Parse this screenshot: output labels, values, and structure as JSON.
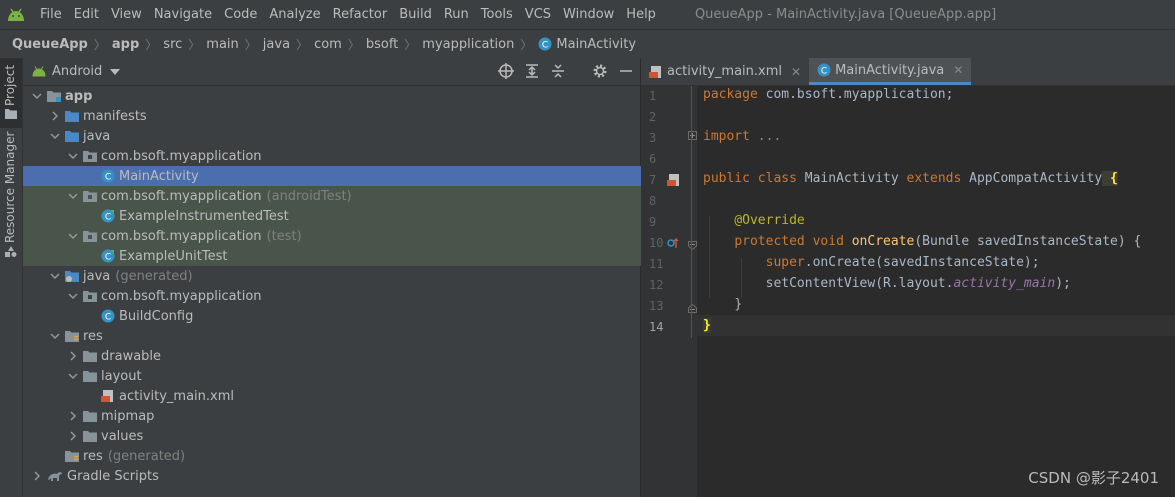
{
  "menubar": {
    "items": [
      "File",
      "Edit",
      "View",
      "Navigate",
      "Code",
      "Analyze",
      "Refactor",
      "Build",
      "Run",
      "Tools",
      "VCS",
      "Window",
      "Help"
    ],
    "window_title": "QueueApp - MainActivity.java [QueueApp.app]"
  },
  "breadcrumb": [
    "QueueApp",
    "app",
    "src",
    "main",
    "java",
    "com",
    "bsoft",
    "myapplication",
    "MainActivity"
  ],
  "stripe": {
    "project_tab": "Project",
    "resource_tab": "Resource Manager"
  },
  "project_panel": {
    "view_selector": "Android"
  },
  "tree": {
    "app": "app",
    "manifests": "manifests",
    "java": "java",
    "pkg_main": "com.bsoft.myapplication",
    "main_activity": "MainActivity",
    "pkg_android_test": "com.bsoft.myapplication",
    "android_test_tag": "(androidTest)",
    "instrumented_test": "ExampleInstrumentedTest",
    "pkg_test": "com.bsoft.myapplication",
    "test_tag": "(test)",
    "unit_test": "ExampleUnitTest",
    "java_generated": "java",
    "generated_tag": "(generated)",
    "pkg_generated": "com.bsoft.myapplication",
    "build_config": "BuildConfig",
    "res": "res",
    "drawable": "drawable",
    "layout": "layout",
    "activity_main_xml": "activity_main.xml",
    "mipmap": "mipmap",
    "values": "values",
    "res_generated": "res",
    "res_generated_tag": "(generated)",
    "gradle_scripts": "Gradle Scripts"
  },
  "editor_tabs": [
    {
      "label": "activity_main.xml"
    },
    {
      "label": "MainActivity.java"
    }
  ],
  "code": {
    "line_numbers": [
      "1",
      "2",
      "3",
      "6",
      "7",
      "8",
      "9",
      "10",
      "11",
      "12",
      "13",
      "14"
    ],
    "l1_kw": "package",
    "l1_rest": " com.bsoft.myapplication;",
    "l3_kw": "import",
    "l3_rest": " ...",
    "l7_kw1": "public",
    "l7_kw2": " class",
    "l7_name": " MainActivity",
    "l7_kw3": " extends",
    "l7_parent": " AppCompatActivity",
    "l7_brace": " {",
    "l9_annot": "@Override",
    "l10_kw1": "protected",
    "l10_kw2": " void",
    "l10_fn": " onCreate",
    "l10_rest": "(Bundle savedInstanceState) {",
    "l11_kw": "super",
    "l11_rest": ".onCreate(savedInstanceState);",
    "l12_a": "setContentView(R.layout.",
    "l12_it": "activity_main",
    "l12_b": ");",
    "l13": "}",
    "l14": "}"
  },
  "watermark": "CSDN @影子2401"
}
